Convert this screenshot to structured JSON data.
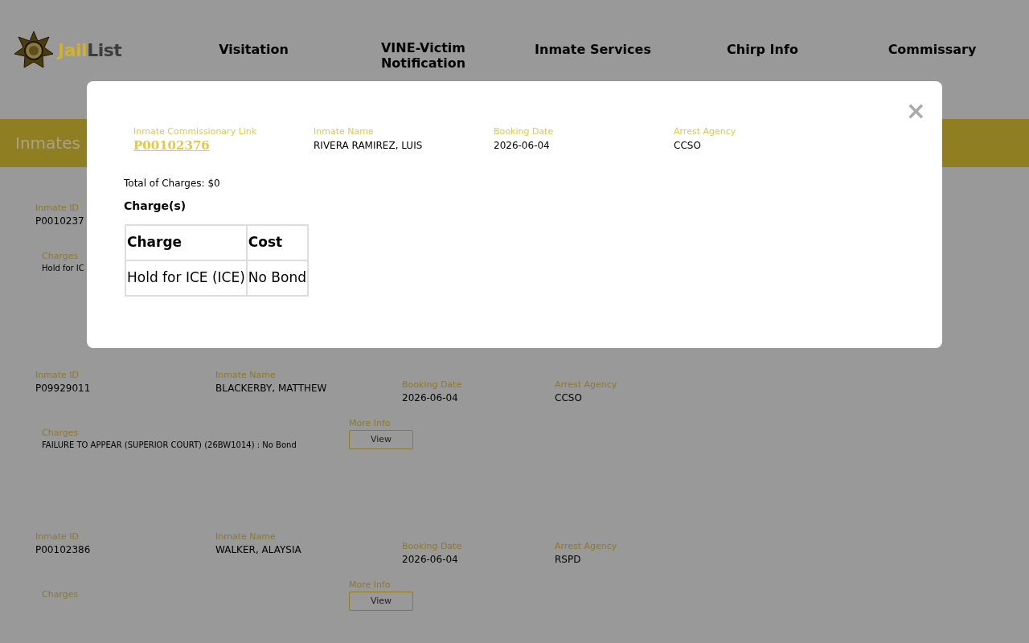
{
  "header": {
    "logo": {
      "text_1": "Jail",
      "text_2": "List"
    },
    "nav": [
      "Visitation",
      "VINE-Victim Notification",
      "Inmate Services",
      "Chirp Info",
      "Commissary"
    ]
  },
  "banner": {
    "title": "Inmates"
  },
  "records": [
    {
      "fields": [
        {
          "label": "Inmate ID",
          "value": "P0010237"
        }
      ],
      "charges_label": "Charges",
      "charges": "Hold for IC"
    },
    {
      "fields": [
        {
          "label": "Inmate ID",
          "value": "P09929011"
        },
        {
          "label": "Inmate Name",
          "value": "BLACKERBY, MATTHEW"
        },
        {
          "label": "Booking Date",
          "value": "2026-06-04"
        },
        {
          "label": "Arrest Agency",
          "value": "CCSO"
        }
      ],
      "charges_label": "Charges",
      "charges": "FAILURE TO APPEAR (SUPERIOR COURT) (26BW1014) : No Bond",
      "more_info_label": "More Info",
      "button": "View"
    },
    {
      "fields": [
        {
          "label": "Inmate ID",
          "value": "P00102386"
        },
        {
          "label": "Inmate Name",
          "value": "WALKER, ALAYSIA"
        },
        {
          "label": "Booking Date",
          "value": "2026-06-04"
        },
        {
          "label": "Arrest Agency",
          "value": "RSPD"
        }
      ],
      "charges_label": "Charges",
      "more_info_label": "More Info",
      "button": "View"
    }
  ],
  "modal": {
    "close": "×",
    "fields": [
      {
        "label": "Inmate Commissionary Link",
        "value": "P00102376",
        "kind": "link"
      },
      {
        "label": "Inmate Name",
        "value": "RIVERA RAMIREZ, LUIS",
        "kind": "text"
      },
      {
        "label": "Booking Date",
        "value": "2026-06-04",
        "kind": "text"
      },
      {
        "label": "Arrest Agency",
        "value": "CCSO",
        "kind": "text"
      }
    ],
    "total": "Total of Charges: $0",
    "charges_title": "Charge(s)",
    "table": {
      "columns": [
        "Charge",
        "Cost"
      ],
      "rows": [
        [
          "Hold for ICE (ICE)",
          "No Bond"
        ]
      ]
    }
  }
}
